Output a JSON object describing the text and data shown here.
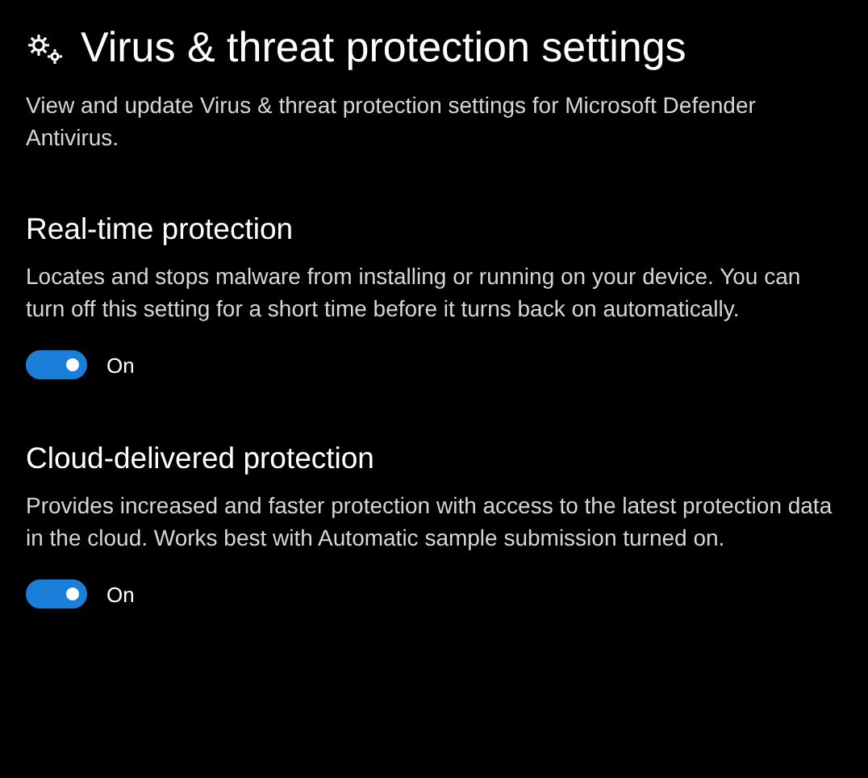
{
  "title": "Virus & threat protection settings",
  "description": "View and update Virus & threat protection settings for Microsoft Defender Antivirus.",
  "sections": [
    {
      "heading": "Real-time protection",
      "text": "Locates and stops malware from installing or running on your device. You can turn off this setting for a short time before it turns back on automatically.",
      "toggle": {
        "on": true,
        "label": "On"
      }
    },
    {
      "heading": "Cloud-delivered protection",
      "text": "Provides increased and faster protection with access to the latest protection data in the cloud. Works best with Automatic sample submission turned on.",
      "toggle": {
        "on": true,
        "label": "On"
      }
    }
  ]
}
